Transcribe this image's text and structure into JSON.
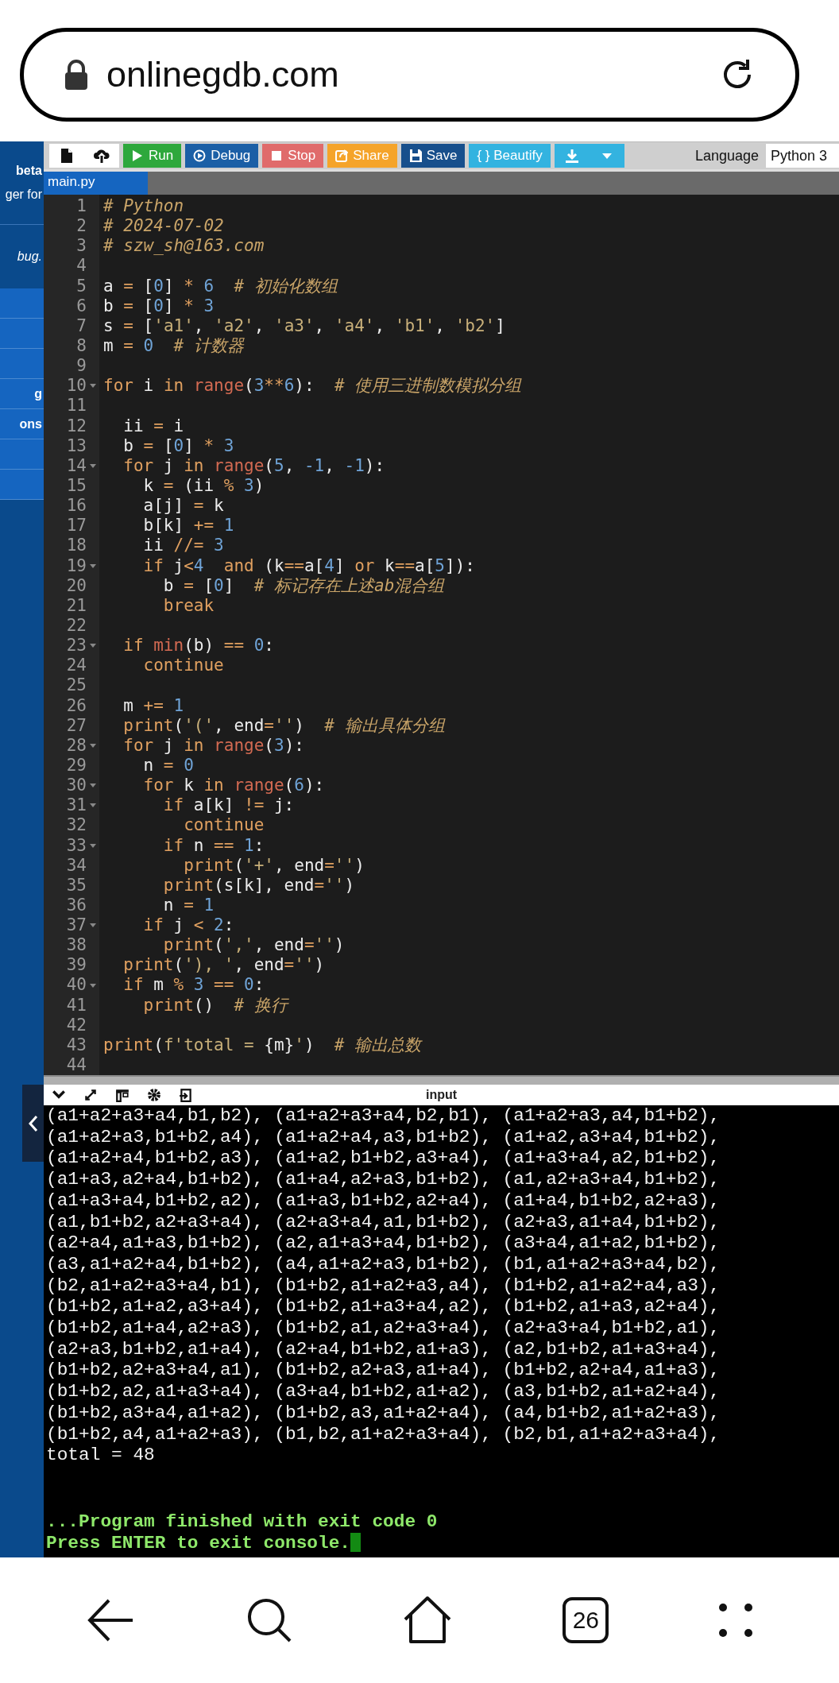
{
  "address_bar": {
    "url": "onlinegdb.com"
  },
  "sidebar": {
    "header_lines": [
      "beta",
      "ger for"
    ],
    "note": "bug.",
    "items": [
      {
        "kind": "blank"
      },
      {
        "kind": "blank"
      },
      {
        "kind": "blank"
      },
      {
        "kind": "text",
        "label": "g"
      },
      {
        "kind": "text",
        "label": "ons"
      },
      {
        "kind": "blank"
      },
      {
        "kind": "blank"
      }
    ]
  },
  "toolbar": {
    "buttons": [
      {
        "label": "Run",
        "color": "#2ea83c"
      },
      {
        "label": "Debug",
        "color": "#1b5fa6"
      },
      {
        "label": "Stop",
        "color": "#e06b6b"
      },
      {
        "label": "Share",
        "color": "#f5a42a"
      },
      {
        "label": "Save",
        "color": "#174f8c"
      },
      {
        "label": "{ } Beautify",
        "color": "#33b3e0"
      }
    ],
    "language": {
      "label": "Language",
      "value": "Python 3"
    }
  },
  "file_tabs": [
    {
      "label": "main.py",
      "selected": true
    }
  ],
  "editor": {
    "lines": [
      {
        "number": "1",
        "foldable": false,
        "tokens": [
          {
            "kind": "comment",
            "text": "# Python"
          }
        ]
      },
      {
        "number": "2",
        "foldable": false,
        "tokens": [
          {
            "kind": "comment",
            "text": "# 2024-07-02"
          }
        ]
      },
      {
        "number": "3",
        "foldable": false,
        "tokens": [
          {
            "kind": "comment",
            "text": "# szw_sh@163.com"
          }
        ]
      },
      {
        "number": "4",
        "foldable": false
      },
      {
        "number": "5",
        "foldable": false,
        "tokens": [
          {
            "kind": "plain",
            "text": "a "
          },
          {
            "kind": "operator",
            "text": "="
          },
          {
            "kind": "plain",
            "text": " ["
          },
          {
            "kind": "number",
            "text": "0"
          },
          {
            "kind": "plain",
            "text": "] "
          },
          {
            "kind": "operator",
            "text": "* "
          },
          {
            "kind": "number",
            "text": "6  "
          },
          {
            "kind": "comment",
            "text": "# 初始化数组"
          }
        ]
      },
      {
        "number": "6",
        "foldable": false,
        "tokens": [
          {
            "kind": "plain",
            "text": "b "
          },
          {
            "kind": "operator",
            "text": "="
          },
          {
            "kind": "plain",
            "text": " ["
          },
          {
            "kind": "number",
            "text": "0"
          },
          {
            "kind": "plain",
            "text": "] "
          },
          {
            "kind": "operator",
            "text": "* "
          },
          {
            "kind": "number",
            "text": "3"
          }
        ]
      },
      {
        "number": "7",
        "foldable": false,
        "tokens": [
          {
            "kind": "plain",
            "text": "s "
          },
          {
            "kind": "operator",
            "text": "="
          },
          {
            "kind": "plain",
            "text": " ["
          },
          {
            "kind": "string",
            "text": "'a1'"
          },
          {
            "kind": "plain",
            "text": ", "
          },
          {
            "kind": "string",
            "text": "'a2'"
          },
          {
            "kind": "plain",
            "text": ", "
          },
          {
            "kind": "string",
            "text": "'a3'"
          },
          {
            "kind": "plain",
            "text": ", "
          },
          {
            "kind": "string",
            "text": "'a4'"
          },
          {
            "kind": "plain",
            "text": ", "
          },
          {
            "kind": "string",
            "text": "'b1'"
          },
          {
            "kind": "plain",
            "text": ", "
          },
          {
            "kind": "string",
            "text": "'b2'"
          },
          {
            "kind": "plain",
            "text": "]"
          }
        ]
      },
      {
        "number": "8",
        "foldable": false,
        "tokens": [
          {
            "kind": "plain",
            "text": "m "
          },
          {
            "kind": "operator",
            "text": "= "
          },
          {
            "kind": "number",
            "text": "0  "
          },
          {
            "kind": "comment",
            "text": "# 计数器"
          }
        ]
      },
      {
        "number": "9",
        "foldable": false
      },
      {
        "number": "10",
        "foldable": true,
        "tokens": [
          {
            "kind": "keyword",
            "text": "for"
          },
          {
            "kind": "plain",
            "text": " i "
          },
          {
            "kind": "keyword",
            "text": "in "
          },
          {
            "kind": "builtin",
            "text": "range"
          },
          {
            "kind": "plain",
            "text": "("
          },
          {
            "kind": "number",
            "text": "3"
          },
          {
            "kind": "operator",
            "text": "**"
          },
          {
            "kind": "number",
            "text": "6"
          },
          {
            "kind": "plain",
            "text": "):  "
          },
          {
            "kind": "comment",
            "text": "# 使用三进制数模拟分组"
          }
        ]
      },
      {
        "number": "11",
        "foldable": false
      },
      {
        "number": "12",
        "foldable": false,
        "tokens": [
          {
            "kind": "plain",
            "text": "  ii "
          },
          {
            "kind": "operator",
            "text": "="
          },
          {
            "kind": "plain",
            "text": " i"
          }
        ]
      },
      {
        "number": "13",
        "foldable": false,
        "tokens": [
          {
            "kind": "plain",
            "text": "  b "
          },
          {
            "kind": "operator",
            "text": "="
          },
          {
            "kind": "plain",
            "text": " ["
          },
          {
            "kind": "number",
            "text": "0"
          },
          {
            "kind": "plain",
            "text": "] "
          },
          {
            "kind": "operator",
            "text": "* "
          },
          {
            "kind": "number",
            "text": "3"
          }
        ]
      },
      {
        "number": "14",
        "foldable": true,
        "tokens": [
          {
            "kind": "keyword",
            "text": "  for"
          },
          {
            "kind": "plain",
            "text": " j "
          },
          {
            "kind": "keyword",
            "text": "in "
          },
          {
            "kind": "builtin",
            "text": "range"
          },
          {
            "kind": "plain",
            "text": "("
          },
          {
            "kind": "number",
            "text": "5"
          },
          {
            "kind": "plain",
            "text": ", "
          },
          {
            "kind": "number",
            "text": "-1"
          },
          {
            "kind": "plain",
            "text": ", "
          },
          {
            "kind": "number",
            "text": "-1"
          },
          {
            "kind": "plain",
            "text": "):"
          }
        ]
      },
      {
        "number": "15",
        "foldable": false,
        "tokens": [
          {
            "kind": "plain",
            "text": "    k "
          },
          {
            "kind": "operator",
            "text": "="
          },
          {
            "kind": "plain",
            "text": " (ii "
          },
          {
            "kind": "operator",
            "text": "% "
          },
          {
            "kind": "number",
            "text": "3"
          },
          {
            "kind": "plain",
            "text": ")"
          }
        ]
      },
      {
        "number": "16",
        "foldable": false,
        "tokens": [
          {
            "kind": "plain",
            "text": "    a[j] "
          },
          {
            "kind": "operator",
            "text": "="
          },
          {
            "kind": "plain",
            "text": " k"
          }
        ]
      },
      {
        "number": "17",
        "foldable": false,
        "tokens": [
          {
            "kind": "plain",
            "text": "    b[k] "
          },
          {
            "kind": "operator",
            "text": "+= "
          },
          {
            "kind": "number",
            "text": "1"
          }
        ]
      },
      {
        "number": "18",
        "foldable": false,
        "tokens": [
          {
            "kind": "plain",
            "text": "    ii "
          },
          {
            "kind": "operator",
            "text": "//= "
          },
          {
            "kind": "number",
            "text": "3"
          }
        ]
      },
      {
        "number": "19",
        "foldable": true,
        "tokens": [
          {
            "kind": "keyword",
            "text": "    if"
          },
          {
            "kind": "plain",
            "text": " j"
          },
          {
            "kind": "operator",
            "text": "<"
          },
          {
            "kind": "number",
            "text": "4  "
          },
          {
            "kind": "keyword",
            "text": "and"
          },
          {
            "kind": "plain",
            "text": " (k"
          },
          {
            "kind": "operator",
            "text": "=="
          },
          {
            "kind": "plain",
            "text": "a["
          },
          {
            "kind": "number",
            "text": "4"
          },
          {
            "kind": "plain",
            "text": "] "
          },
          {
            "kind": "keyword",
            "text": "or"
          },
          {
            "kind": "plain",
            "text": " k"
          },
          {
            "kind": "operator",
            "text": "=="
          },
          {
            "kind": "plain",
            "text": "a["
          },
          {
            "kind": "number",
            "text": "5"
          },
          {
            "kind": "plain",
            "text": "]):"
          }
        ]
      },
      {
        "number": "20",
        "foldable": false,
        "tokens": [
          {
            "kind": "plain",
            "text": "      b "
          },
          {
            "kind": "operator",
            "text": "="
          },
          {
            "kind": "plain",
            "text": " ["
          },
          {
            "kind": "number",
            "text": "0"
          },
          {
            "kind": "plain",
            "text": "]  "
          },
          {
            "kind": "comment",
            "text": "# 标记存在上述ab混合组"
          }
        ]
      },
      {
        "number": "21",
        "foldable": false,
        "tokens": [
          {
            "kind": "keyword",
            "text": "      break"
          }
        ]
      },
      {
        "number": "22",
        "foldable": false
      },
      {
        "number": "23",
        "foldable": true,
        "tokens": [
          {
            "kind": "keyword",
            "text": "  if "
          },
          {
            "kind": "builtin",
            "text": "min"
          },
          {
            "kind": "plain",
            "text": "(b) "
          },
          {
            "kind": "operator",
            "text": "== "
          },
          {
            "kind": "number",
            "text": "0"
          },
          {
            "kind": "plain",
            "text": ":"
          }
        ]
      },
      {
        "number": "24",
        "foldable": false,
        "tokens": [
          {
            "kind": "keyword",
            "text": "    continue"
          }
        ]
      },
      {
        "number": "25",
        "foldable": false
      },
      {
        "number": "26",
        "foldable": false,
        "tokens": [
          {
            "kind": "plain",
            "text": "  m "
          },
          {
            "kind": "operator",
            "text": "+= "
          },
          {
            "kind": "number",
            "text": "1"
          }
        ]
      },
      {
        "number": "27",
        "foldable": false,
        "tokens": [
          {
            "kind": "keyword",
            "text": "  print"
          },
          {
            "kind": "plain",
            "text": "("
          },
          {
            "kind": "string",
            "text": "'('"
          },
          {
            "kind": "plain",
            "text": ", end"
          },
          {
            "kind": "operator",
            "text": "="
          },
          {
            "kind": "string",
            "text": "''"
          },
          {
            "kind": "plain",
            "text": ")  "
          },
          {
            "kind": "comment",
            "text": "# 输出具体分组"
          }
        ]
      },
      {
        "number": "28",
        "foldable": true,
        "tokens": [
          {
            "kind": "keyword",
            "text": "  for"
          },
          {
            "kind": "plain",
            "text": " j "
          },
          {
            "kind": "keyword",
            "text": "in "
          },
          {
            "kind": "builtin",
            "text": "range"
          },
          {
            "kind": "plain",
            "text": "("
          },
          {
            "kind": "number",
            "text": "3"
          },
          {
            "kind": "plain",
            "text": "):"
          }
        ]
      },
      {
        "number": "29",
        "foldable": false,
        "tokens": [
          {
            "kind": "plain",
            "text": "    n "
          },
          {
            "kind": "operator",
            "text": "= "
          },
          {
            "kind": "number",
            "text": "0"
          }
        ]
      },
      {
        "number": "30",
        "foldable": true,
        "tokens": [
          {
            "kind": "keyword",
            "text": "    for"
          },
          {
            "kind": "plain",
            "text": " k "
          },
          {
            "kind": "keyword",
            "text": "in "
          },
          {
            "kind": "builtin",
            "text": "range"
          },
          {
            "kind": "plain",
            "text": "("
          },
          {
            "kind": "number",
            "text": "6"
          },
          {
            "kind": "plain",
            "text": "):"
          }
        ]
      },
      {
        "number": "31",
        "foldable": true,
        "tokens": [
          {
            "kind": "keyword",
            "text": "      if"
          },
          {
            "kind": "plain",
            "text": " a[k] "
          },
          {
            "kind": "operator",
            "text": "!="
          },
          {
            "kind": "plain",
            "text": " j:"
          }
        ]
      },
      {
        "number": "32",
        "foldable": false,
        "tokens": [
          {
            "kind": "keyword",
            "text": "        continue"
          }
        ]
      },
      {
        "number": "33",
        "foldable": true,
        "tokens": [
          {
            "kind": "keyword",
            "text": "      if"
          },
          {
            "kind": "plain",
            "text": " n "
          },
          {
            "kind": "operator",
            "text": "== "
          },
          {
            "kind": "number",
            "text": "1"
          },
          {
            "kind": "plain",
            "text": ":"
          }
        ]
      },
      {
        "number": "34",
        "foldable": false,
        "tokens": [
          {
            "kind": "keyword",
            "text": "        print"
          },
          {
            "kind": "plain",
            "text": "("
          },
          {
            "kind": "string",
            "text": "'+'"
          },
          {
            "kind": "plain",
            "text": ", end"
          },
          {
            "kind": "operator",
            "text": "="
          },
          {
            "kind": "string",
            "text": "''"
          },
          {
            "kind": "plain",
            "text": ")"
          }
        ]
      },
      {
        "number": "35",
        "foldable": false,
        "tokens": [
          {
            "kind": "keyword",
            "text": "      print"
          },
          {
            "kind": "plain",
            "text": "(s[k], end"
          },
          {
            "kind": "operator",
            "text": "="
          },
          {
            "kind": "string",
            "text": "''"
          },
          {
            "kind": "plain",
            "text": ")"
          }
        ]
      },
      {
        "number": "36",
        "foldable": false,
        "tokens": [
          {
            "kind": "plain",
            "text": "      n "
          },
          {
            "kind": "operator",
            "text": "= "
          },
          {
            "kind": "number",
            "text": "1"
          }
        ]
      },
      {
        "number": "37",
        "foldable": true,
        "tokens": [
          {
            "kind": "keyword",
            "text": "    if"
          },
          {
            "kind": "plain",
            "text": " j "
          },
          {
            "kind": "operator",
            "text": "< "
          },
          {
            "kind": "number",
            "text": "2"
          },
          {
            "kind": "plain",
            "text": ":"
          }
        ]
      },
      {
        "number": "38",
        "foldable": false,
        "tokens": [
          {
            "kind": "keyword",
            "text": "      print"
          },
          {
            "kind": "plain",
            "text": "("
          },
          {
            "kind": "string",
            "text": "','"
          },
          {
            "kind": "plain",
            "text": ", end"
          },
          {
            "kind": "operator",
            "text": "="
          },
          {
            "kind": "string",
            "text": "''"
          },
          {
            "kind": "plain",
            "text": ")"
          }
        ]
      },
      {
        "number": "39",
        "foldable": false,
        "tokens": [
          {
            "kind": "keyword",
            "text": "  print"
          },
          {
            "kind": "plain",
            "text": "("
          },
          {
            "kind": "string",
            "text": "'), '"
          },
          {
            "kind": "plain",
            "text": ", end"
          },
          {
            "kind": "operator",
            "text": "="
          },
          {
            "kind": "string",
            "text": "''"
          },
          {
            "kind": "plain",
            "text": ")"
          }
        ]
      },
      {
        "number": "40",
        "foldable": true,
        "tokens": [
          {
            "kind": "keyword",
            "text": "  if"
          },
          {
            "kind": "plain",
            "text": " m "
          },
          {
            "kind": "operator",
            "text": "% "
          },
          {
            "kind": "number",
            "text": "3 "
          },
          {
            "kind": "operator",
            "text": "== "
          },
          {
            "kind": "number",
            "text": "0"
          },
          {
            "kind": "plain",
            "text": ":"
          }
        ]
      },
      {
        "number": "41",
        "foldable": false,
        "tokens": [
          {
            "kind": "keyword",
            "text": "    print"
          },
          {
            "kind": "plain",
            "text": "()  "
          },
          {
            "kind": "comment",
            "text": "# 换行"
          }
        ]
      },
      {
        "number": "42",
        "foldable": false
      },
      {
        "number": "43",
        "foldable": false,
        "tokens": [
          {
            "kind": "keyword",
            "text": "print"
          },
          {
            "kind": "plain",
            "text": "("
          },
          {
            "kind": "string",
            "text": "f'total = "
          },
          {
            "kind": "plain",
            "text": "{m}"
          },
          {
            "kind": "string",
            "text": "'"
          },
          {
            "kind": "plain",
            "text": ")  "
          },
          {
            "kind": "comment",
            "text": "# 输出总数"
          }
        ]
      },
      {
        "number": "44",
        "foldable": false
      }
    ]
  },
  "console": {
    "title": "input",
    "output_lines": [
      "(a1+a2+a3+a4,b1,b2), (a1+a2+a3+a4,b2,b1), (a1+a2+a3,a4,b1+b2),",
      "(a1+a2+a3,b1+b2,a4), (a1+a2+a4,a3,b1+b2), (a1+a2,a3+a4,b1+b2),",
      "(a1+a2+a4,b1+b2,a3), (a1+a2,b1+b2,a3+a4), (a1+a3+a4,a2,b1+b2),",
      "(a1+a3,a2+a4,b1+b2), (a1+a4,a2+a3,b1+b2), (a1,a2+a3+a4,b1+b2),",
      "(a1+a3+a4,b1+b2,a2), (a1+a3,b1+b2,a2+a4), (a1+a4,b1+b2,a2+a3),",
      "(a1,b1+b2,a2+a3+a4), (a2+a3+a4,a1,b1+b2), (a2+a3,a1+a4,b1+b2),",
      "(a2+a4,a1+a3,b1+b2), (a2,a1+a3+a4,b1+b2), (a3+a4,a1+a2,b1+b2),",
      "(a3,a1+a2+a4,b1+b2), (a4,a1+a2+a3,b1+b2), (b1,a1+a2+a3+a4,b2),",
      "(b2,a1+a2+a3+a4,b1), (b1+b2,a1+a2+a3,a4), (b1+b2,a1+a2+a4,a3),",
      "(b1+b2,a1+a2,a3+a4), (b1+b2,a1+a3+a4,a2), (b1+b2,a1+a3,a2+a4),",
      "(b1+b2,a1+a4,a2+a3), (b1+b2,a1,a2+a3+a4), (a2+a3+a4,b1+b2,a1),",
      "(a2+a3,b1+b2,a1+a4), (a2+a4,b1+b2,a1+a3), (a2,b1+b2,a1+a3+a4),",
      "(b1+b2,a2+a3+a4,a1), (b1+b2,a2+a3,a1+a4), (b1+b2,a2+a4,a1+a3),",
      "(b1+b2,a2,a1+a3+a4), (a3+a4,b1+b2,a1+a2), (a3,b1+b2,a1+a2+a4),",
      "(b1+b2,a3+a4,a1+a2), (b1+b2,a3,a1+a2+a4), (a4,b1+b2,a1+a2+a3),",
      "(b1+b2,a4,a1+a2+a3), (b1,b2,a1+a2+a3+a4), (b2,b1,a1+a2+a3+a4),",
      "total = 48"
    ],
    "status_lines": [
      "...Program finished with exit code 0",
      "Press ENTER to exit console."
    ]
  },
  "navigation_bar": {
    "tab_count": "26"
  }
}
